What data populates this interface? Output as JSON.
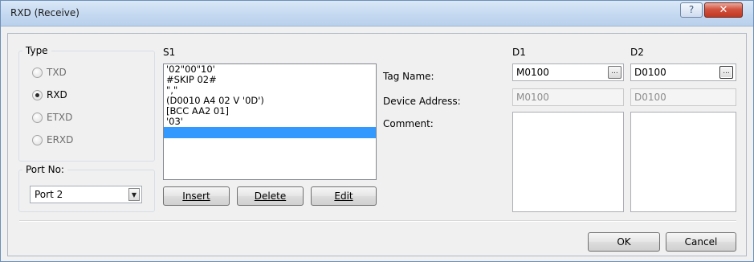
{
  "window": {
    "title": "RXD (Receive)",
    "help_glyph": "?",
    "close_glyph": "✕"
  },
  "type_group": {
    "legend": "Type",
    "options": [
      {
        "label": "TXD",
        "checked": false
      },
      {
        "label": "RXD",
        "checked": true
      },
      {
        "label": "ETXD",
        "checked": false
      },
      {
        "label": "ERXD",
        "checked": false
      }
    ]
  },
  "port_group": {
    "legend": "Port No:",
    "value": "Port 2",
    "dropdown_glyph": "▼"
  },
  "s1": {
    "label": "S1",
    "items": [
      "'02\"00\"10'",
      "#SKIP 02#",
      "\",\"",
      "(D0010 A4 02 V '0D')",
      "[BCC AA2 01]",
      "'03'",
      ""
    ],
    "selected_index": 6,
    "buttons": {
      "insert": "Insert",
      "delete": "Delete",
      "edit": "Edit"
    }
  },
  "fields": {
    "tag_name": "Tag Name:",
    "device_address": "Device Address:",
    "comment": "Comment:"
  },
  "d1": {
    "label": "D1",
    "tag_name": "M0100",
    "device_address": "M0100",
    "comment": ""
  },
  "d2": {
    "label": "D2",
    "tag_name": "D0100",
    "device_address": "D0100",
    "comment": ""
  },
  "browse_glyph": "...",
  "footer": {
    "ok": "OK",
    "cancel": "Cancel"
  }
}
